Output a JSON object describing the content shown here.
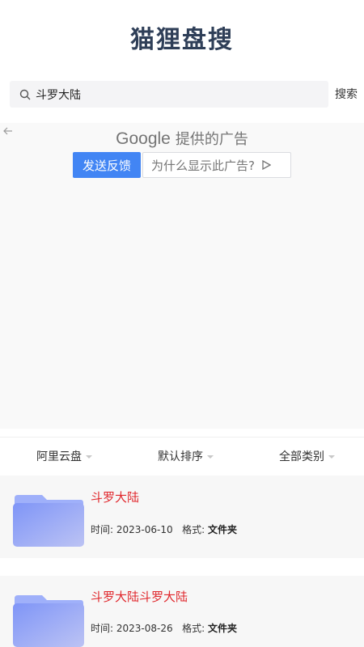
{
  "header": {
    "title": "猫狸盘搜"
  },
  "search": {
    "value": "斗罗大陆",
    "button_label": "搜索"
  },
  "ad": {
    "provider_brand": "Google",
    "provider_text": "提供的广告",
    "feedback_label": "发送反馈",
    "why_label": "为什么显示此广告?"
  },
  "filters": [
    {
      "label": "阿里云盘"
    },
    {
      "label": "默认排序"
    },
    {
      "label": "全部类别"
    }
  ],
  "results": [
    {
      "title": "斗罗大陆",
      "time_label": "时间:",
      "time": "2023-06-10",
      "format_label": "格式:",
      "format": "文件夹"
    },
    {
      "title": "斗罗大陆斗罗大陆",
      "time_label": "时间:",
      "time": "2023-08-26",
      "format_label": "格式:",
      "format": "文件夹"
    }
  ],
  "colors": {
    "title": "#2f3f58",
    "result_title": "#e0262b",
    "ad_button": "#4285f4"
  }
}
